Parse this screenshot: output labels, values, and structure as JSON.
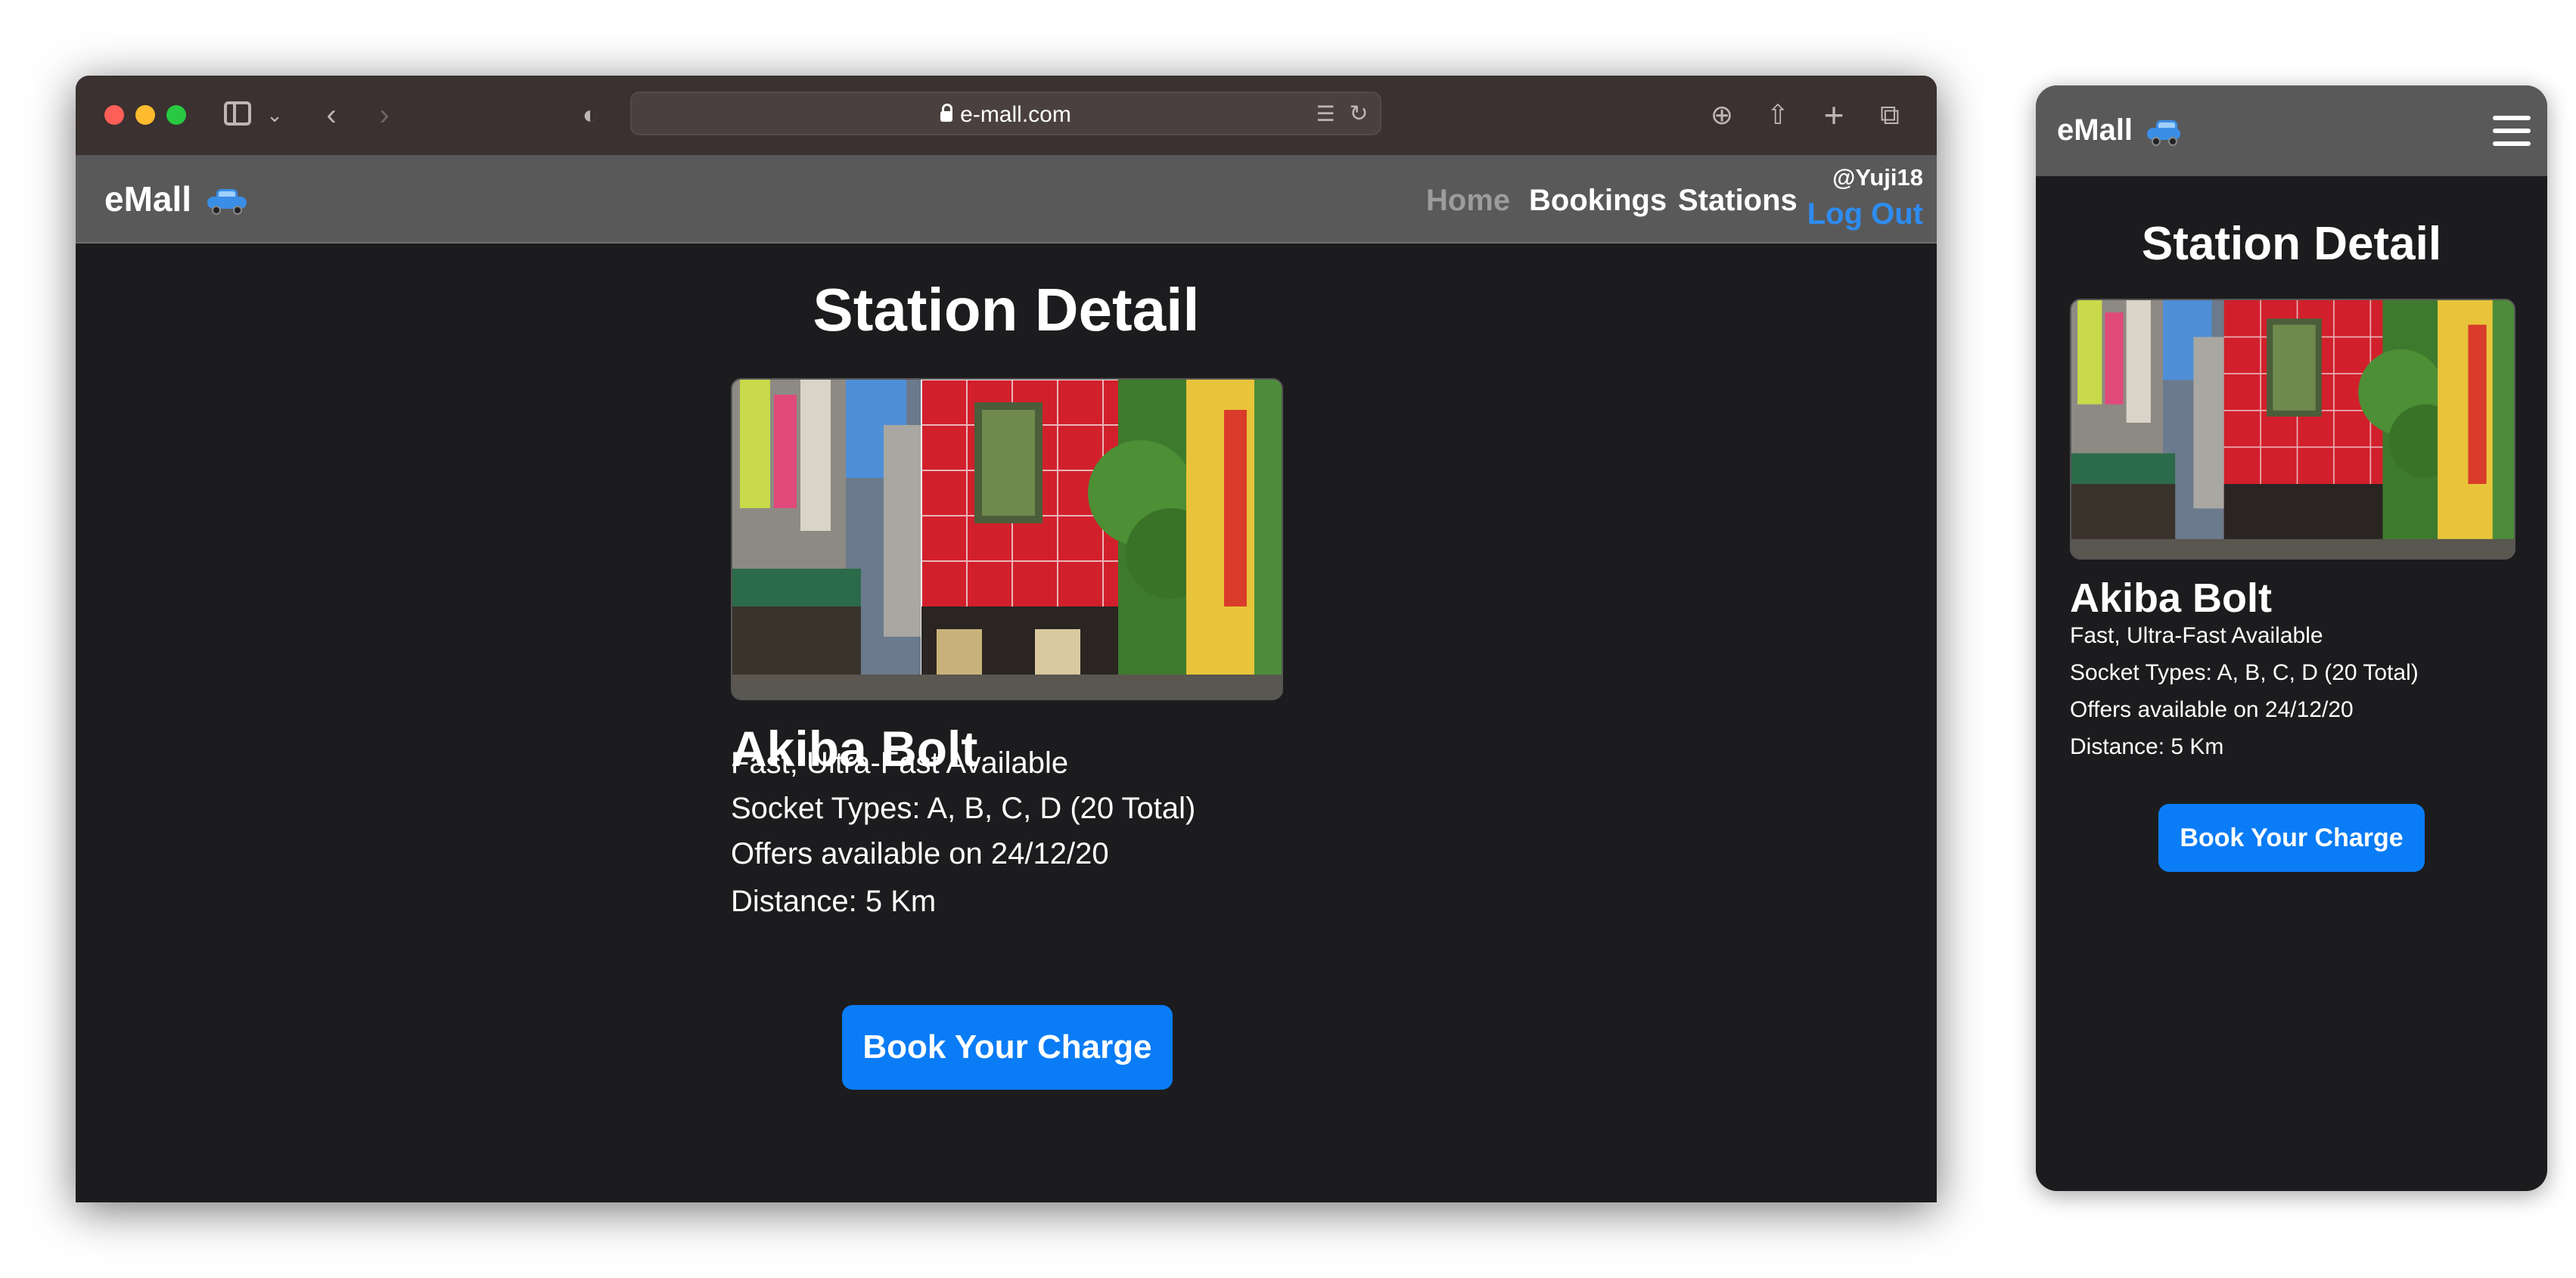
{
  "browser": {
    "url": "e-mall.com"
  },
  "navbar": {
    "brand": "eMall",
    "brand_icon": "car-emoji",
    "links": [
      "Home",
      "Bookings",
      "Stations"
    ],
    "active_link": "Home",
    "user": "@Yuji18",
    "logout": "Log Out"
  },
  "page": {
    "title": "Station Detail"
  },
  "station": {
    "name": "Akiba Bolt",
    "speed": "Fast, Ultra-Fast Available",
    "sockets": "Socket Types: A, B, C, D (20 Total)",
    "offers": "Offers available on 24/12/20",
    "distance": "Distance: 5 Km",
    "image_alt": "station-photo"
  },
  "actions": {
    "book": "Book Your Charge"
  },
  "colors": {
    "accent": "#0a7cf6",
    "logout": "#2e8cf0",
    "navbar": "#59595a",
    "background": "#1c1c1e"
  }
}
